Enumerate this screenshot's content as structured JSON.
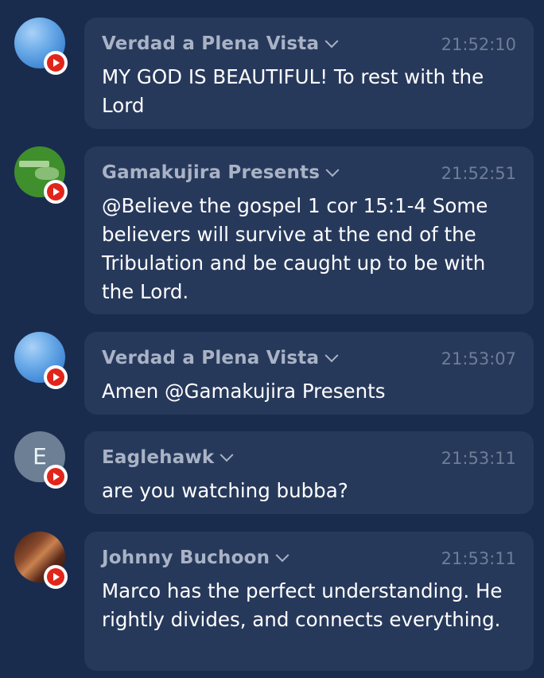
{
  "colors": {
    "background": "#1a2c4e",
    "bubble": "#27395b",
    "author": "#a9b3c5",
    "timestamp": "#6f7d95",
    "message": "#ffffff",
    "youtube_red": "#e1251b"
  },
  "messages": [
    {
      "author": "Verdad a Plena Vista",
      "time": "21:52:10",
      "text": "MY GOD IS BEAUTIFUL! To rest with the Lord",
      "avatar": "sky-photo",
      "platform_icon": "youtube-icon"
    },
    {
      "author": "Gamakujira Presents",
      "time": "21:52:51",
      "text": "@Believe the gospel 1 cor 15:1-4 Some believers will survive at the end of the Tribulation and be caught up to be with the Lord.",
      "avatar": "green-logo",
      "platform_icon": "youtube-icon"
    },
    {
      "author": "Verdad a Plena Vista",
      "time": "21:53:07",
      "text": "Amen @Gamakujira Presents",
      "avatar": "sky-photo",
      "platform_icon": "youtube-icon"
    },
    {
      "author": "Eaglehawk",
      "time": "21:53:11",
      "text": "are you watching bubba?",
      "avatar_initial": "E",
      "platform_icon": "youtube-icon"
    },
    {
      "author": "Johnny Buchoon",
      "time": "21:53:11",
      "text": "Marco has the perfect understanding. He rightly divides, and connects everything.",
      "avatar": "portrait-photo",
      "platform_icon": "youtube-icon"
    }
  ]
}
